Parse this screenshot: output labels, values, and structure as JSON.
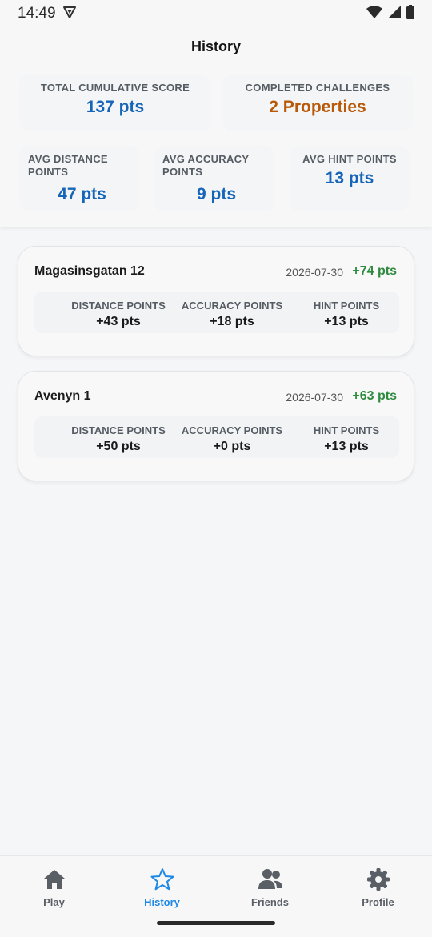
{
  "status_bar": {
    "time": "14:49"
  },
  "header": {
    "title": "History"
  },
  "summary": {
    "total_label": "TOTAL CUMULATIVE SCORE",
    "total_value": "137 pts",
    "completed_label": "COMPLETED CHALLENGES",
    "completed_value": "2 Properties",
    "avg_distance_label": "AVG DISTANCE POINTS",
    "avg_distance_value": "47 pts",
    "avg_accuracy_label": "AVG ACCURACY POINTS",
    "avg_accuracy_value": "9 pts",
    "avg_hint_label": "AVG HINT POINTS",
    "avg_hint_value": "13 pts"
  },
  "history": [
    {
      "name": "Magasinsgatan 12",
      "date": "2026-07-30",
      "points": "+74 pts",
      "distance_label": "DISTANCE POINTS",
      "distance_value": "+43 pts",
      "accuracy_label": "ACCURACY POINTS",
      "accuracy_value": "+18 pts",
      "hint_label": "HINT POINTS",
      "hint_value": "+13 pts"
    },
    {
      "name": "Avenyn 1",
      "date": "2026-07-30",
      "points": "+63 pts",
      "distance_label": "DISTANCE POINTS",
      "distance_value": "+50 pts",
      "accuracy_label": "ACCURACY POINTS",
      "accuracy_value": "+0 pts",
      "hint_label": "HINT POINTS",
      "hint_value": "+13 pts"
    }
  ],
  "nav": {
    "play": "Play",
    "history": "History",
    "friends": "Friends",
    "profile": "Profile",
    "active": "history"
  },
  "colors": {
    "accent_blue": "#1565b8",
    "accent_orange": "#b85a09",
    "points_green": "#2e8a3e",
    "active_nav": "#1e88e5"
  },
  "icons": {
    "play": "home-icon",
    "history": "star-icon",
    "friends": "people-icon",
    "profile": "gear-icon"
  }
}
